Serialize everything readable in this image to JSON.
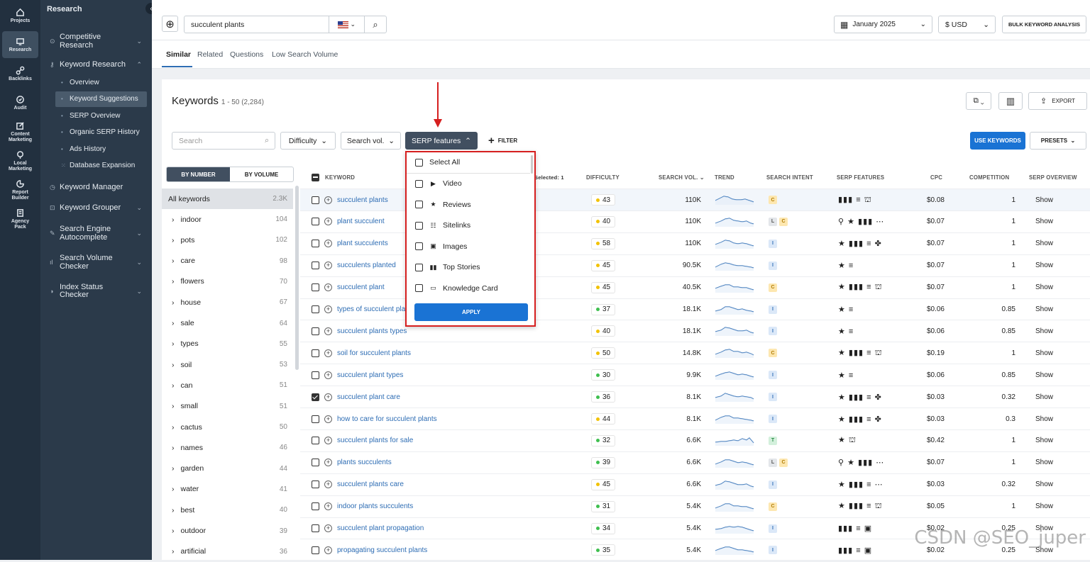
{
  "rail": [
    {
      "label": "Projects",
      "icon": "home-icon"
    },
    {
      "label": "Research",
      "icon": "research-icon",
      "active": true
    },
    {
      "label": "Backlinks",
      "icon": "link-icon"
    },
    {
      "label": "Audit",
      "icon": "audit-icon"
    },
    {
      "label": "Content Marketing",
      "icon": "edit-icon"
    },
    {
      "label": "Local Marketing",
      "icon": "pin-icon"
    },
    {
      "label": "Report Builder",
      "icon": "report-icon"
    },
    {
      "label": "Agency Pack",
      "icon": "building-icon"
    }
  ],
  "nav": {
    "title": "Research",
    "competitive": "Competitive Research",
    "keyword_research": "Keyword Research",
    "subs": [
      "Overview",
      "Keyword Suggestions",
      "SERP Overview",
      "Organic SERP History",
      "Ads History",
      "Database Expansion"
    ],
    "keyword_manager": "Keyword Manager",
    "keyword_grouper": "Keyword Grouper",
    "autocomplete": "Search Engine Autocomplete",
    "volume_checker": "Search Volume Checker",
    "index_checker": "Index Status Checker"
  },
  "topbar": {
    "search_value": "succulent plants",
    "date": "January 2025",
    "currency": "$ USD",
    "bulk": "BULK KEYWORD ANALYSIS"
  },
  "tabs": [
    "Similar",
    "Related",
    "Questions",
    "Low Search Volume"
  ],
  "card": {
    "title": "Keywords",
    "count": "1 - 50 (2,284)",
    "export": "EXPORT",
    "search_placeholder": "Search",
    "difficulty": "Difficulty",
    "search_vol": "Search vol.",
    "serp_features": "SERP features",
    "filter": "FILTER",
    "use_keywords": "USE KEYWORDS",
    "presets": "PRESETS"
  },
  "groups": {
    "by_number": "BY NUMBER",
    "by_volume": "BY VOLUME",
    "all_label": "All keywords",
    "all_count": "2.3K",
    "items": [
      {
        "name": "indoor",
        "count": "104"
      },
      {
        "name": "pots",
        "count": "102"
      },
      {
        "name": "care",
        "count": "98"
      },
      {
        "name": "flowers",
        "count": "70"
      },
      {
        "name": "house",
        "count": "67"
      },
      {
        "name": "sale",
        "count": "64"
      },
      {
        "name": "types",
        "count": "55"
      },
      {
        "name": "soil",
        "count": "53"
      },
      {
        "name": "can",
        "count": "51"
      },
      {
        "name": "small",
        "count": "51"
      },
      {
        "name": "cactus",
        "count": "50"
      },
      {
        "name": "names",
        "count": "46"
      },
      {
        "name": "garden",
        "count": "44"
      },
      {
        "name": "water",
        "count": "41"
      },
      {
        "name": "best",
        "count": "40"
      },
      {
        "name": "outdoor",
        "count": "39"
      },
      {
        "name": "artificial",
        "count": "36"
      }
    ]
  },
  "headers": {
    "keyword": "KEYWORD",
    "selected": "Selected: 1",
    "difficulty": "DIFFICULTY",
    "volume": "SEARCH VOL.",
    "trend": "TREND",
    "intent": "SEARCH INTENT",
    "serp": "SERP FEATURES",
    "cpc": "CPC",
    "competition": "COMPETITION",
    "overview": "SERP OVERVIEW"
  },
  "rows": [
    {
      "kw": "succulent plants",
      "diff": "43",
      "dc": "#f2c200",
      "vol": "110K",
      "intent": [
        "C"
      ],
      "serp": "▮▮▮ ≡ ⛫",
      "cpc": "$0.08",
      "comp": "1",
      "ov": "Show",
      "checked": false,
      "hl": true
    },
    {
      "kw": "plant succulent",
      "diff": "40",
      "dc": "#f2c200",
      "vol": "110K",
      "intent": [
        "L",
        "C"
      ],
      "serp": "⚲ ★ ▮▮▮ ⋯",
      "cpc": "$0.07",
      "comp": "1",
      "ov": "Show",
      "checked": false
    },
    {
      "kw": "plant succulents",
      "diff": "58",
      "dc": "#f2c200",
      "vol": "110K",
      "intent": [
        "I"
      ],
      "serp": "★ ▮▮▮ ≡ ✤",
      "cpc": "$0.07",
      "comp": "1",
      "ov": "Show",
      "checked": false
    },
    {
      "kw": "succulents planted",
      "diff": "45",
      "dc": "#f2c200",
      "vol": "90.5K",
      "intent": [
        "I"
      ],
      "serp": "★ ≡",
      "cpc": "$0.07",
      "comp": "1",
      "ov": "Show",
      "checked": false
    },
    {
      "kw": "succulent plant",
      "diff": "45",
      "dc": "#f2c200",
      "vol": "40.5K",
      "intent": [
        "C"
      ],
      "serp": "★ ▮▮▮ ≡ ⛫",
      "cpc": "$0.07",
      "comp": "1",
      "ov": "Show",
      "checked": false
    },
    {
      "kw": "types of succulent plants",
      "diff": "37",
      "dc": "#3fbf4f",
      "vol": "18.1K",
      "intent": [
        "I"
      ],
      "serp": "★ ≡",
      "cpc": "$0.06",
      "comp": "0.85",
      "ov": "Show",
      "checked": false
    },
    {
      "kw": "succulent plants types",
      "diff": "40",
      "dc": "#f2c200",
      "vol": "18.1K",
      "intent": [
        "I"
      ],
      "serp": "★ ≡",
      "cpc": "$0.06",
      "comp": "0.85",
      "ov": "Show",
      "checked": false
    },
    {
      "kw": "soil for succulent plants",
      "diff": "50",
      "dc": "#f2c200",
      "vol": "14.8K",
      "intent": [
        "C"
      ],
      "serp": "★ ▮▮▮ ≡ ⛫",
      "cpc": "$0.19",
      "comp": "1",
      "ov": "Show",
      "checked": false
    },
    {
      "kw": "succulent plant types",
      "diff": "30",
      "dc": "#3fbf4f",
      "vol": "9.9K",
      "intent": [
        "I"
      ],
      "serp": "★ ≡",
      "cpc": "$0.06",
      "comp": "0.85",
      "ov": "Show",
      "checked": false
    },
    {
      "kw": "succulent plant care",
      "diff": "36",
      "dc": "#3fbf4f",
      "vol": "8.1K",
      "intent": [
        "I"
      ],
      "serp": "★ ▮▮▮ ≡ ✤",
      "cpc": "$0.03",
      "comp": "0.32",
      "ov": "Show",
      "checked": true
    },
    {
      "kw": "how to care for succulent plants",
      "diff": "44",
      "dc": "#f2c200",
      "vol": "8.1K",
      "intent": [
        "I"
      ],
      "serp": "★ ▮▮▮ ≡ ✤",
      "cpc": "$0.03",
      "comp": "0.3",
      "ov": "Show",
      "checked": false
    },
    {
      "kw": "succulent plants for sale",
      "diff": "32",
      "dc": "#3fbf4f",
      "vol": "6.6K",
      "intent": [
        "T"
      ],
      "serp": "★ ⛫",
      "cpc": "$0.42",
      "comp": "1",
      "ov": "Show",
      "checked": false
    },
    {
      "kw": "plants succulents",
      "diff": "39",
      "dc": "#3fbf4f",
      "vol": "6.6K",
      "intent": [
        "L",
        "C"
      ],
      "serp": "⚲ ★ ▮▮▮ ⋯",
      "cpc": "$0.07",
      "comp": "1",
      "ov": "Show",
      "checked": false
    },
    {
      "kw": "succulent plants care",
      "diff": "45",
      "dc": "#f2c200",
      "vol": "6.6K",
      "intent": [
        "I"
      ],
      "serp": "★ ▮▮▮ ≡ ⋯",
      "cpc": "$0.03",
      "comp": "0.32",
      "ov": "Show",
      "checked": false
    },
    {
      "kw": "indoor plants succulents",
      "diff": "31",
      "dc": "#3fbf4f",
      "vol": "5.4K",
      "intent": [
        "C"
      ],
      "serp": "★ ▮▮▮ ≡ ⛫",
      "cpc": "$0.05",
      "comp": "1",
      "ov": "Show",
      "checked": false
    },
    {
      "kw": "succulent plant propagation",
      "diff": "34",
      "dc": "#3fbf4f",
      "vol": "5.4K",
      "intent": [
        "I"
      ],
      "serp": "▮▮▮ ≡ ▣",
      "cpc": "$0.02",
      "comp": "0.25",
      "ov": "Show",
      "checked": false
    },
    {
      "kw": "propagating succulent plants",
      "diff": "35",
      "dc": "#3fbf4f",
      "vol": "5.4K",
      "intent": [
        "I"
      ],
      "serp": "▮▮▮ ≡ ▣",
      "cpc": "$0.02",
      "comp": "0.25",
      "ov": "Show",
      "checked": false
    }
  ],
  "dropdown": {
    "items": [
      {
        "label": "Select All",
        "icon": ""
      },
      {
        "label": "Video",
        "icon": "▶"
      },
      {
        "label": "Reviews",
        "icon": "★"
      },
      {
        "label": "Sitelinks",
        "icon": "☷"
      },
      {
        "label": "Images",
        "icon": "▣"
      },
      {
        "label": "Top Stories",
        "icon": "▮▮"
      },
      {
        "label": "Knowledge Card",
        "icon": "▭"
      }
    ],
    "apply": "APPLY"
  },
  "intent_colors": {
    "C": "#fde7b0",
    "L": "#e3e6ea",
    "I": "#dbe8f8",
    "T": "#d3f0dc"
  },
  "intent_text": {
    "C": "#b07a00",
    "L": "#555",
    "I": "#2e6db4",
    "T": "#2a8a45"
  },
  "watermark": "CSDN @SEO_juper"
}
